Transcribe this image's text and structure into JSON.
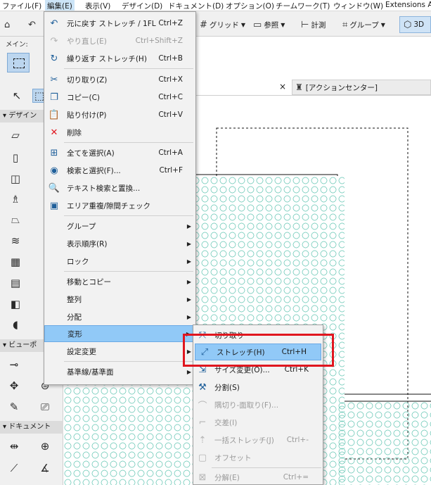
{
  "menubar": {
    "items": [
      "ファイル(F)",
      "編集(E)",
      "表示(V)",
      "デザイン(D)",
      "ドキュメント(D)",
      "オプション(O)",
      "チームワーク(T)",
      "ウィンドウ(W)",
      "Extensions A"
    ]
  },
  "toolbar": {
    "grid_label": "グリッド",
    "reference_label": "参照",
    "measure_label": "計測",
    "group_label": "グループ",
    "view3d_label": "3D"
  },
  "infobox": {
    "main_label": "メイン:"
  },
  "toolbox": {
    "design_section": "デザイン",
    "viewpoint_section": "ビューポ",
    "document_section": "ドキュメント"
  },
  "canvas": {
    "tab_label": "[アクションセンター]",
    "close_glyph": "×"
  },
  "edit_menu": {
    "items": [
      {
        "icon": "undo-icon",
        "glyph": "↶",
        "label": "元に戻す ストレッチ / 1FL",
        "shortcut": "Ctrl+Z",
        "disabled": false
      },
      {
        "icon": "redo-icon",
        "glyph": "↷",
        "label": "やり直し(E)",
        "shortcut": "Ctrl+Shift+Z",
        "disabled": true
      },
      {
        "icon": "repeat-icon",
        "glyph": "↻",
        "label": "繰り返す ストレッチ(H)",
        "shortcut": "Ctrl+B",
        "disabled": false
      },
      {
        "icon": "cut-icon",
        "glyph": "✂",
        "label": "切り取り(Z)",
        "shortcut": "Ctrl+X",
        "disabled": false
      },
      {
        "icon": "copy-icon",
        "glyph": "❐",
        "label": "コピー(C)",
        "shortcut": "Ctrl+C",
        "disabled": false
      },
      {
        "icon": "paste-icon",
        "glyph": "📋",
        "label": "貼り付け(P)",
        "shortcut": "Ctrl+V",
        "disabled": false
      },
      {
        "icon": "delete-icon",
        "glyph": "✕",
        "label": "削除",
        "shortcut": "",
        "disabled": false
      },
      {
        "icon": "select-all-icon",
        "glyph": "⊞",
        "label": "全てを選択(A)",
        "shortcut": "Ctrl+A",
        "disabled": false
      },
      {
        "icon": "find-select-icon",
        "glyph": "◉",
        "label": "検索と選択(F)...",
        "shortcut": "Ctrl+F",
        "disabled": false
      },
      {
        "icon": "find-replace-text-icon",
        "glyph": "🔍",
        "label": "テキスト検索と置換...",
        "shortcut": "",
        "disabled": false
      },
      {
        "icon": "area-check-icon",
        "glyph": "▣",
        "label": "エリア重複/隙間チェック",
        "shortcut": "",
        "disabled": false
      },
      {
        "icon": "",
        "glyph": "",
        "label": "グループ",
        "shortcut": "",
        "disabled": false,
        "submenu": true
      },
      {
        "icon": "",
        "glyph": "",
        "label": "表示順序(R)",
        "shortcut": "",
        "disabled": false,
        "submenu": true
      },
      {
        "icon": "",
        "glyph": "",
        "label": "ロック",
        "shortcut": "",
        "disabled": false,
        "submenu": true
      },
      {
        "icon": "",
        "glyph": "",
        "label": "移動とコピー",
        "shortcut": "",
        "disabled": false,
        "submenu": true
      },
      {
        "icon": "",
        "glyph": "",
        "label": "整列",
        "shortcut": "",
        "disabled": false,
        "submenu": true
      },
      {
        "icon": "",
        "glyph": "",
        "label": "分配",
        "shortcut": "",
        "disabled": false,
        "submenu": true
      },
      {
        "icon": "",
        "glyph": "",
        "label": "変形",
        "shortcut": "",
        "disabled": false,
        "submenu": true,
        "highlighted": true
      },
      {
        "icon": "",
        "glyph": "",
        "label": "設定変更",
        "shortcut": "",
        "disabled": false,
        "submenu": true
      },
      {
        "icon": "",
        "glyph": "",
        "label": "基準線/基準面",
        "shortcut": "",
        "disabled": false,
        "submenu": true
      }
    ]
  },
  "transform_submenu": {
    "items": [
      {
        "icon": "drag-icon",
        "glyph": "⤧",
        "label": "切り取り",
        "shortcut": "",
        "disabled": false
      },
      {
        "icon": "stretch-icon",
        "glyph": "⤢",
        "label": "ストレッチ(H)",
        "shortcut": "Ctrl+H",
        "disabled": false,
        "highlighted": true
      },
      {
        "icon": "resize-icon",
        "glyph": "⇲",
        "label": "サイズ変更(O)...",
        "shortcut": "Ctrl+K",
        "disabled": false
      },
      {
        "icon": "split-icon",
        "glyph": "⚒",
        "label": "分割(S)",
        "shortcut": "",
        "disabled": false
      },
      {
        "icon": "fillet-chamfer-icon",
        "glyph": "⌒",
        "label": "隅切り-面取り(F)...",
        "shortcut": "",
        "disabled": true
      },
      {
        "icon": "intersect-icon",
        "glyph": "⌐",
        "label": "交差(I)",
        "shortcut": "",
        "disabled": true
      },
      {
        "icon": "batch-stretch-icon",
        "glyph": "⇡",
        "label": "一括ストレッチ(J)",
        "shortcut": "Ctrl+-",
        "disabled": true
      },
      {
        "icon": "offset-icon",
        "glyph": "▢",
        "label": "オフセット",
        "shortcut": "",
        "disabled": true
      },
      {
        "icon": "explode-icon",
        "glyph": "⊠",
        "label": "分解(E)",
        "shortcut": "Ctrl+=",
        "disabled": true
      }
    ]
  },
  "colors": {
    "highlight": "#91c9f7",
    "annotation_box": "#e0161f",
    "hatch": "#7fcfc0"
  }
}
